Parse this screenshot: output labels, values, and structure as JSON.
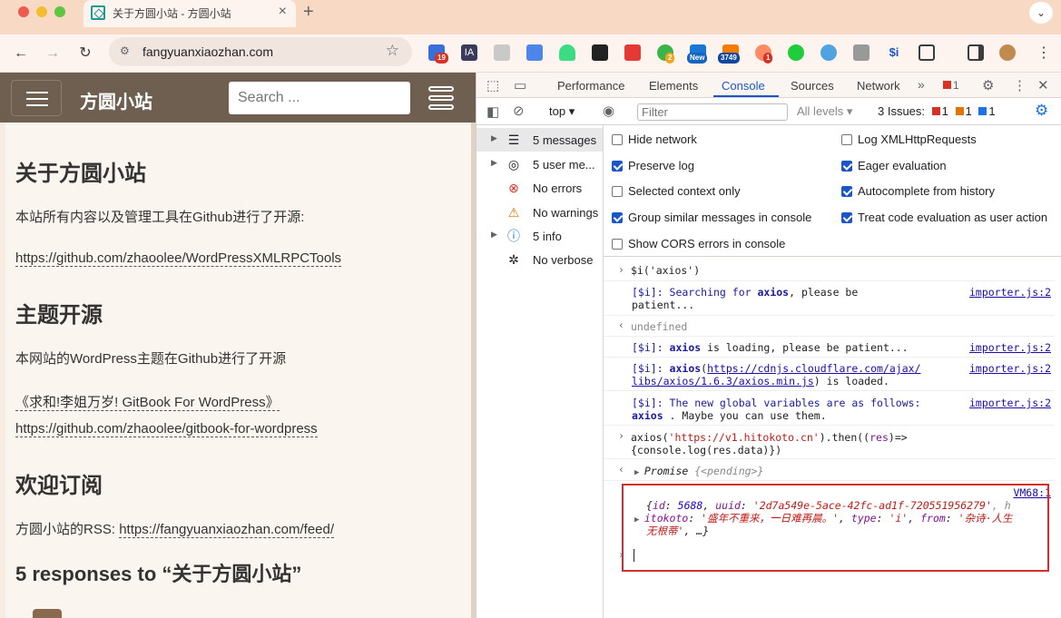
{
  "browser": {
    "tab_title": "关于方圆小站 - 方圆小站",
    "url": "fangyuanxiaozhan.com",
    "extension_badges": [
      "19",
      "2",
      "New",
      "3749",
      "1"
    ],
    "extension_labels": [
      "IA",
      "$i"
    ]
  },
  "site": {
    "name": "方圆小站",
    "search_placeholder": "Search ...",
    "h_about": "关于方圆小站",
    "p_about": "本站所有内容以及管理工具在Github进行了开源:",
    "link_tools": "https://github.com/zhaoolee/WordPressXMLRPCTools",
    "h_theme": "主题开源",
    "p_theme": "本网站的WordPress主题在Github进行了开源",
    "link_gitbook_title": "《求和!李姐万岁! GitBook For WordPress》",
    "link_gitbook": "https://github.com/zhaoolee/gitbook-for-wordpress",
    "h_subscribe": "欢迎订阅",
    "rss_label": "方圆小站的RSS: ",
    "rss_link": "https://fangyuanxiaozhan.com/feed/",
    "responses": "5 responses to “关于方圆小站”"
  },
  "devtools": {
    "tabs": [
      "Performance",
      "Elements",
      "Console",
      "Sources",
      "Network"
    ],
    "active_tab": "Console",
    "error_count": "1",
    "context": "top",
    "filter_placeholder": "Filter",
    "levels": "All levels",
    "issues_label": "3 Issues:",
    "issue_counts": [
      "1",
      "1",
      "1"
    ],
    "sidebar": [
      {
        "label": "5 messages",
        "icon": "list-icon"
      },
      {
        "label": "5 user me...",
        "icon": "user-icon"
      },
      {
        "label": "No errors",
        "icon": "error-icon"
      },
      {
        "label": "No warnings",
        "icon": "warning-icon"
      },
      {
        "label": "5 info",
        "icon": "info-icon"
      },
      {
        "label": "No verbose",
        "icon": "bug-icon"
      }
    ],
    "settings_left": [
      {
        "label": "Hide network",
        "checked": false
      },
      {
        "label": "Preserve log",
        "checked": true
      },
      {
        "label": "Selected context only",
        "checked": false
      },
      {
        "label": "Group similar messages in console",
        "checked": true
      },
      {
        "label": "Show CORS errors in console",
        "checked": false
      }
    ],
    "settings_right": [
      {
        "label": "Log XMLHttpRequests",
        "checked": false
      },
      {
        "label": "Eager evaluation",
        "checked": true
      },
      {
        "label": "Autocomplete from history",
        "checked": true
      },
      {
        "label": "Treat code evaluation as user action",
        "checked": true
      }
    ],
    "console": {
      "cmd1": "$i('axios')",
      "searching_pre": "[$i]: Searching for ",
      "searching_kw": "axios",
      "searching_post": ", please be",
      "searching_line2": "patient...",
      "source_importer": "importer.js:2",
      "undefined": "undefined",
      "loading_pre": "[$i]: ",
      "loading_kw": "axios",
      "loading_post": " is loading, please be patient...",
      "loaded_pre": "[$i]: ",
      "loaded_kw": "axios",
      "loaded_paren": "(",
      "loaded_url1": "https://cdnjs.cloudflare.com/ajax/",
      "loaded_url2": "libs/axios/1.6.3/axios.min.js",
      "loaded_post": ") is loaded.",
      "globals_pre": "[$i]: The new global variables are as follows:",
      "globals_kw": "axios",
      "globals_post": " . Maybe you can use them.",
      "cmd2_pre": "axios(",
      "cmd2_str": "'https://v1.hitokoto.cn'",
      "cmd2_mid": ").then((",
      "cmd2_res": "res",
      "cmd2_post": ")=>",
      "cmd2_line2": "{console.log(res.data)})",
      "promise_label": "Promise ",
      "promise_state": "{<pending>}",
      "source_vm": "VM68:1",
      "obj_open": "{",
      "obj_id_key": "id",
      "obj_id_val": "5688",
      "obj_uuid_key": "uuid",
      "obj_uuid_val": "'2d7a549e-5ace-42fc-ad1f-720551956279'",
      "obj_h": ", h",
      "obj_hitokoto_key": "itokoto",
      "obj_hitokoto_val": "'盛年不重来，一日难再晨。'",
      "obj_type_key": "type",
      "obj_type_val": "'i'",
      "obj_from_key": "from",
      "obj_from_val": "'杂诗·人生",
      "obj_from_val2": "无根蒂'",
      "obj_close": ", …}"
    }
  },
  "colors": {
    "tabstrip": "#f8d9c4",
    "site_header": "#6f5f51",
    "accent_blue": "#1a56c9",
    "highlight_red": "#d32f2f"
  }
}
